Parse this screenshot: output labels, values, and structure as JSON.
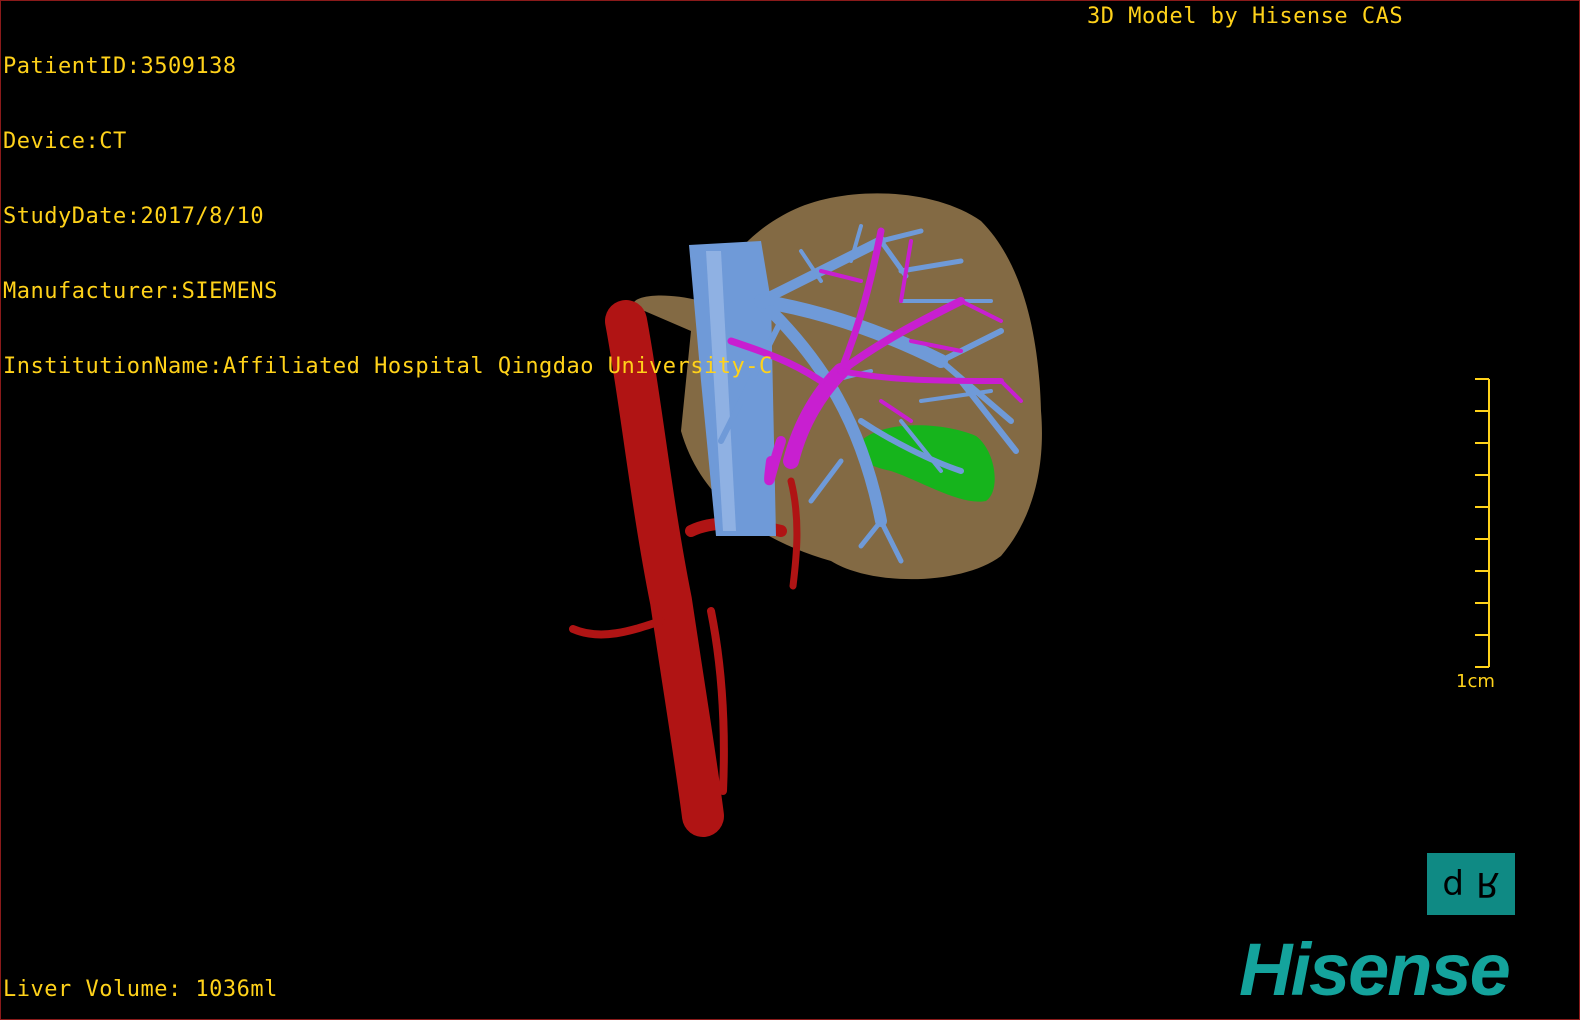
{
  "patient_info": {
    "patient_id": "PatientID:3509138",
    "device": "Device:CT",
    "study_date": "StudyDate:2017/8/10",
    "manufacturer": "Manufacturer:SIEMENS",
    "institution": "InstitutionName:Affiliated Hospital Qingdao University-C"
  },
  "credit": "3D Model by Hisense CAS",
  "scale": {
    "label": "1cm",
    "tick_count": 10
  },
  "orientation": {
    "left_glyph": "d",
    "right_glyph": "R"
  },
  "brand": {
    "name": "Hisense",
    "color": "#14a39c"
  },
  "measurement": {
    "liver_volume": "Liver Volume: 1036ml"
  },
  "colors": {
    "text": "#ffd21a",
    "liver": "#8a7048",
    "aorta": "#b01414",
    "vena_cava": "#6f9ad8",
    "portal_vein": "#c81fd0",
    "hepatic_vein": "#6f9ad8",
    "gallbladder": "#16b41c",
    "widget_bg": "#0f8a84"
  },
  "model_parts": [
    "liver",
    "aorta",
    "inferior-vena-cava",
    "portal-vein",
    "hepatic-veins",
    "gallbladder"
  ]
}
